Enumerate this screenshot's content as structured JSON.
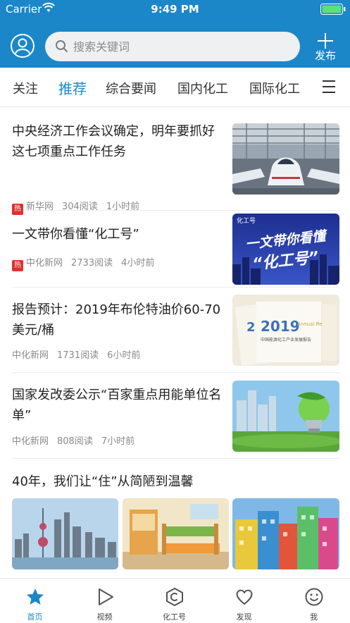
{
  "status_bar": {
    "carrier": "Carrier",
    "time": "9:49 PM"
  },
  "header": {
    "search_placeholder": "搜索关键词",
    "publish_label": "发布"
  },
  "tabs": [
    {
      "label": "关注"
    },
    {
      "label": "推荐"
    },
    {
      "label": "综合要闻"
    },
    {
      "label": "国内化工"
    },
    {
      "label": "国际化工"
    }
  ],
  "active_tab": "推荐",
  "feed": [
    {
      "title": "中央经济工作会议确定，明年要抓好这七项重点工作任务",
      "hot_badge": "热",
      "source": "新华网",
      "reads": "304阅读",
      "time": "1小时前",
      "thumbnail": "train-station"
    },
    {
      "title": "一文带你看懂“化工号”",
      "hot_badge": "热",
      "source": "中化新网",
      "reads": "2733阅读",
      "time": "4小时前",
      "thumbnail": "chemical-account-banner",
      "thumb_text_top": "化工号",
      "thumb_text_main": "一文带你看懂",
      "thumb_text_sub": "“化工号”"
    },
    {
      "title": "报告预计：2019年布伦特油价60-70美元/桶",
      "source": "中化新网",
      "reads": "1731阅读",
      "time": "6小时前",
      "thumbnail": "annual-report",
      "thumb_text_year": "2019",
      "thumb_text_label": "Annual Report",
      "thumb_text_cn": "中国能源化工产业发展报告"
    },
    {
      "title": "国家发改委公示“百家重点用能单位名单”",
      "source": "中化新网",
      "reads": "808阅读",
      "time": "7小时前",
      "thumbnail": "green-energy-bulb"
    },
    {
      "title": "40年，我们让“住”从简陋到温馨",
      "thumbnails": [
        "city-skyline",
        "kids-bedroom",
        "colorful-buildings"
      ]
    }
  ],
  "tabbar": [
    {
      "label": "首页",
      "icon": "star-icon"
    },
    {
      "label": "视频",
      "icon": "play-icon"
    },
    {
      "label": "化工号",
      "icon": "hexagon-icon"
    },
    {
      "label": "发现",
      "icon": "heart-icon"
    },
    {
      "label": "我",
      "icon": "smile-icon"
    }
  ],
  "colors": {
    "brand": "#1b87c9",
    "hot": "#e22f2f"
  }
}
